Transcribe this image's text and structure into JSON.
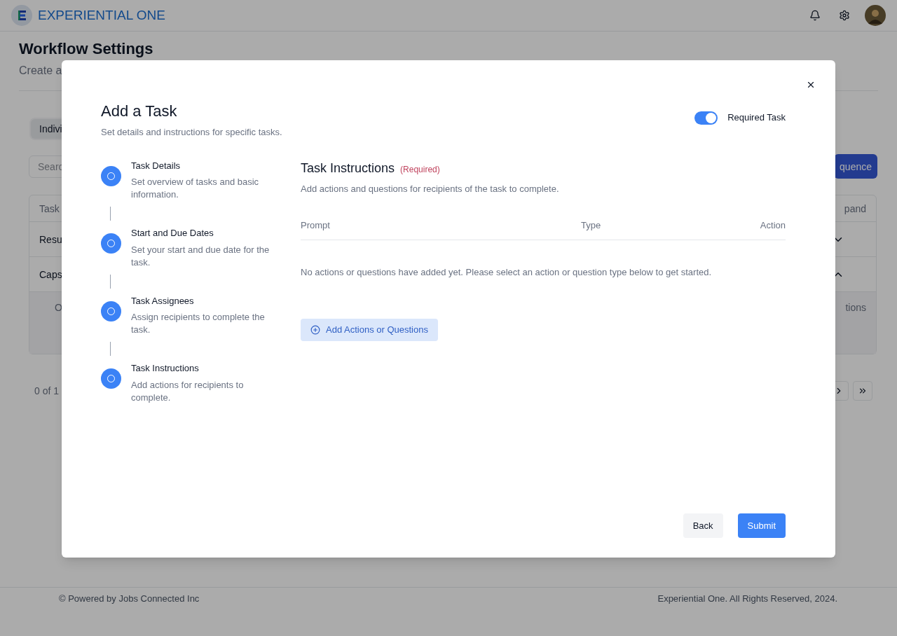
{
  "header": {
    "brand": "EXPERIENTIAL ONE"
  },
  "page": {
    "title": "Workflow Settings",
    "subtitle": "Create a",
    "tabs": [
      {
        "label": "Indivi",
        "selected": true
      }
    ],
    "search": {
      "placeholder": "Searc"
    },
    "sequence_button": "quence",
    "table": {
      "columns": [
        "Task",
        "pand"
      ],
      "rows": [
        {
          "cell": "Resu",
          "expanded": false
        },
        {
          "cell": "Caps",
          "expanded": true
        }
      ],
      "detail": {
        "column_1": "O",
        "column_2": "tions"
      }
    },
    "pagination": {
      "summary": "0 of 1"
    }
  },
  "modal": {
    "title": "Add a Task",
    "subtitle": "Set details and instructions for specific tasks.",
    "required_toggle": {
      "label": "Required Task",
      "on": true
    },
    "steps": [
      {
        "title": "Task Details",
        "description": "Set overview of tasks and basic information."
      },
      {
        "title": "Start and Due Dates",
        "description": "Set your start and due date for the task."
      },
      {
        "title": "Task Assignees",
        "description": "Assign recipients to complete the task."
      },
      {
        "title": "Task Instructions",
        "description": "Add actions for recipients to complete."
      }
    ],
    "section": {
      "title": "Task Instructions",
      "required_note": "(Required)",
      "description": "Add actions and questions for recipients of the task to complete.",
      "columns": [
        "Prompt",
        "Type",
        "Action"
      ],
      "empty_message": "No actions or questions have added yet. Please select an action or question type below to get started.",
      "add_button": "Add Actions or Questions"
    },
    "buttons": {
      "back": "Back",
      "submit": "Submit"
    }
  },
  "footer": {
    "left": "© Powered by Jobs Connected Inc",
    "right": "Experiential One. All Rights Reserved, 2024."
  }
}
